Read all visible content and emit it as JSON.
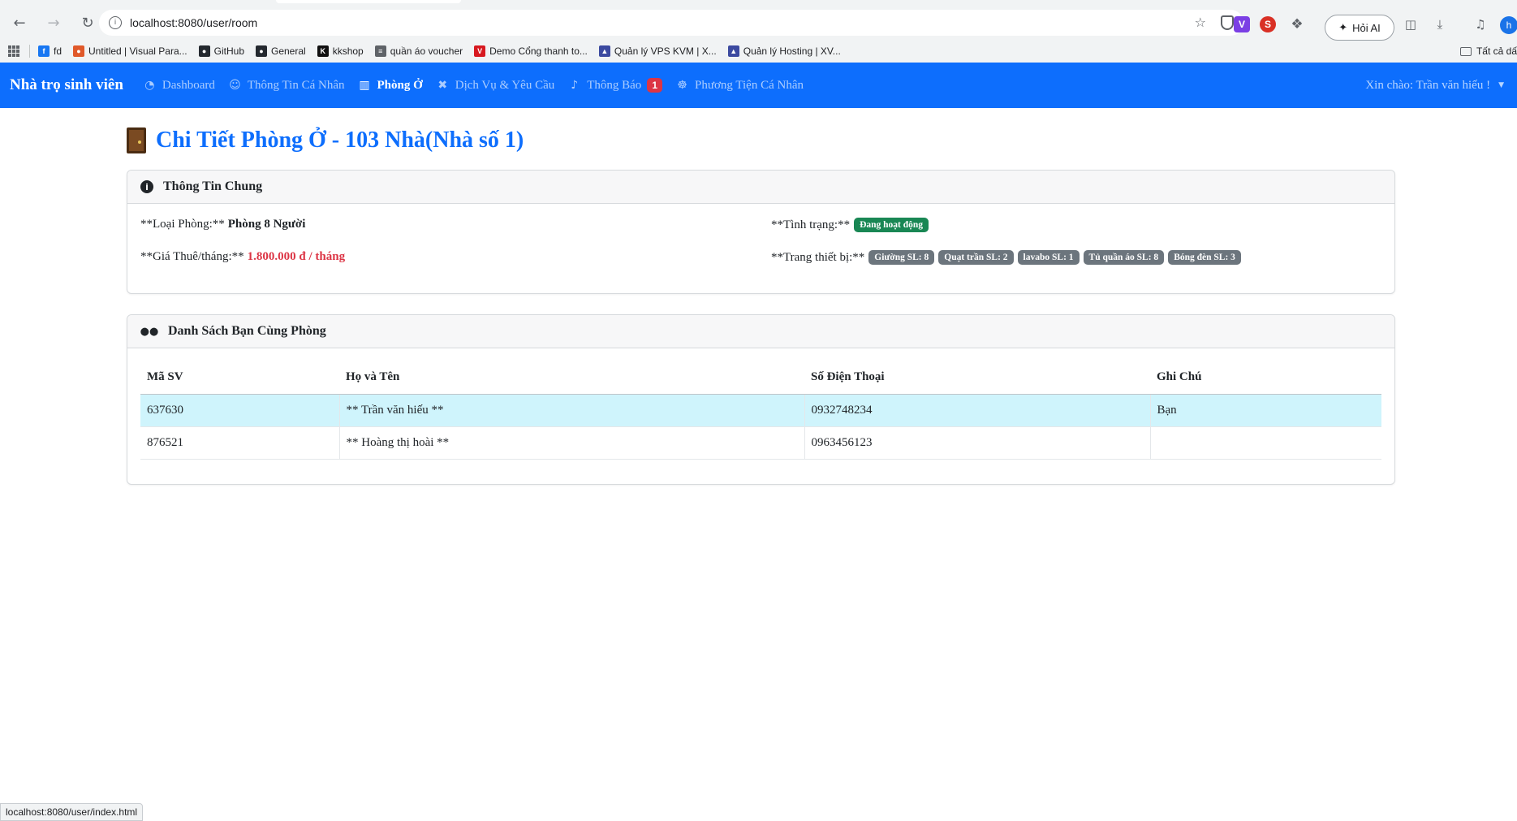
{
  "browser": {
    "url": "localhost:8080/user/room",
    "ai_button_label": "Hỏi AI",
    "profile_initial": "h",
    "bookmarks": [
      {
        "label": "fd",
        "icon": "facebook-icon",
        "color": "#1877f2"
      },
      {
        "label": "Untitled | Visual Para...",
        "icon": "visual-paradigm-icon",
        "color": "#e0592a"
      },
      {
        "label": "GitHub",
        "icon": "github-icon",
        "color": "#24292f"
      },
      {
        "label": "General",
        "icon": "github-icon",
        "color": "#24292f"
      },
      {
        "label": "kkshop",
        "icon": "kkshop-icon",
        "color": "#111111"
      },
      {
        "label": "quần áo voucher",
        "icon": "voucher-icon",
        "color": "#5f6368"
      },
      {
        "label": "Demo Cổng thanh to...",
        "icon": "vnpay-icon",
        "color": "#d71920"
      },
      {
        "label": "Quản lý VPS KVM | X...",
        "icon": "server-icon",
        "color": "#3c4aa0"
      },
      {
        "label": "Quản lý Hosting | XV...",
        "icon": "server-icon",
        "color": "#3c4aa0"
      }
    ],
    "all_bookmarks_label": "Tất cả dấ",
    "status_bar_url": "localhost:8080/user/index.html"
  },
  "navbar": {
    "brand": "Nhà trọ sinh viên",
    "items": [
      {
        "label": "Dashboard",
        "icon": "tachometer-icon",
        "active": false
      },
      {
        "label": "Thông Tin Cá Nhân",
        "icon": "user-icon",
        "active": false
      },
      {
        "label": "Phòng Ở",
        "icon": "building-icon",
        "active": true
      },
      {
        "label": "Dịch Vụ & Yêu Cầu",
        "icon": "tools-icon",
        "active": false
      },
      {
        "label": "Thông Báo",
        "icon": "bell-icon",
        "active": false,
        "badge": "1"
      },
      {
        "label": "Phương Tiện Cá Nhân",
        "icon": "motorcycle-icon",
        "active": false
      }
    ],
    "user_greeting": "Xin chào: Trần văn hiếu !"
  },
  "page": {
    "title": "Chi Tiết Phòng Ở - 103 Nhà(Nhà số 1)"
  },
  "general_info": {
    "header": "Thông Tin Chung",
    "room_type_label": "**Loại Phòng:**",
    "room_type_value": "Phòng 8 Người",
    "price_label": "**Giá Thuê/tháng:**",
    "price_value": "1.800.000 đ / tháng",
    "status_label": "**Tình trạng:**",
    "status_value": "Đang hoạt động",
    "equipment_label": "**Trang thiết bị:**",
    "equipment": [
      "Giường SL: 8",
      "Quạt trần SL: 2",
      "lavabo SL: 1",
      "Tủ quần áo SL: 8",
      "Bóng đèn SL: 3"
    ]
  },
  "roommates": {
    "header": "Danh Sách Bạn Cùng Phòng",
    "columns": [
      "Mã SV",
      "Họ và Tên",
      "Số Điện Thoại",
      "Ghi Chú"
    ],
    "rows": [
      {
        "id": "637630",
        "name": "** Trần văn hiếu **",
        "phone": "0932748234",
        "note": "Bạn"
      },
      {
        "id": "876521",
        "name": "** Hoàng thị hoài **",
        "phone": "0963456123",
        "note": ""
      }
    ]
  },
  "colors": {
    "navbar": "#0d6efd",
    "title": "#0d6efd",
    "price": "#dc3545",
    "status_badge": "#198754",
    "equipment_badge": "#6c757d",
    "highlight_row": "#cff4fc"
  }
}
